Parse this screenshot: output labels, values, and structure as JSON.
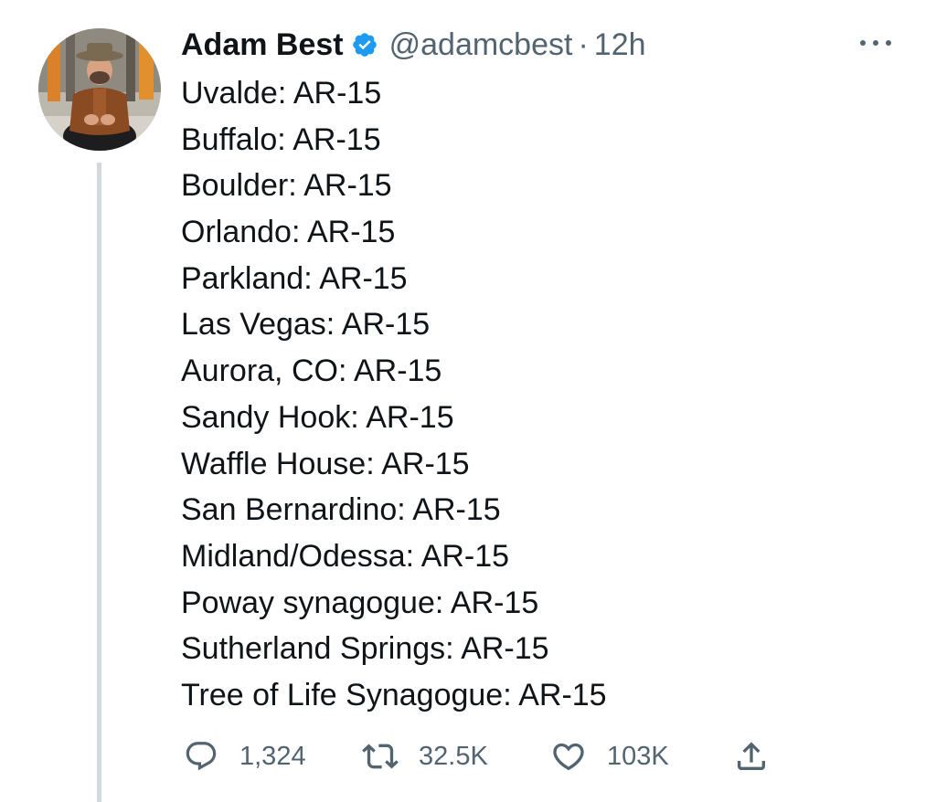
{
  "tweet": {
    "author": {
      "display_name": "Adam Best",
      "handle": "@adamcbest",
      "verified": true,
      "avatar_icon": "profile-photo"
    },
    "separator": "·",
    "time": "12h",
    "more_icon": "more-horizontal-icon",
    "lines": [
      "Uvalde: AR-15",
      "Buffalo: AR-15",
      "Boulder: AR-15",
      "Orlando: AR-15",
      "Parkland: AR-15",
      "Las Vegas: AR-15",
      "Aurora, CO: AR-15",
      "Sandy Hook: AR-15",
      "Waffle House: AR-15",
      "San Bernardino: AR-15",
      "Midland/Odessa: AR-15",
      "Poway synagogue: AR-15",
      "Sutherland Springs: AR-15",
      "Tree of Life Synagogue: AR-15"
    ],
    "actions": {
      "reply": {
        "icon": "reply-icon",
        "count": "1,324"
      },
      "retweet": {
        "icon": "retweet-icon",
        "count": "32.5K"
      },
      "like": {
        "icon": "heart-icon",
        "count": "103K"
      },
      "share": {
        "icon": "share-icon"
      }
    }
  },
  "colors": {
    "text": "#0f1419",
    "secondary": "#536471",
    "verified_blue": "#1d9bf0",
    "thread_line": "#cfd9de",
    "background": "#ffffff"
  }
}
